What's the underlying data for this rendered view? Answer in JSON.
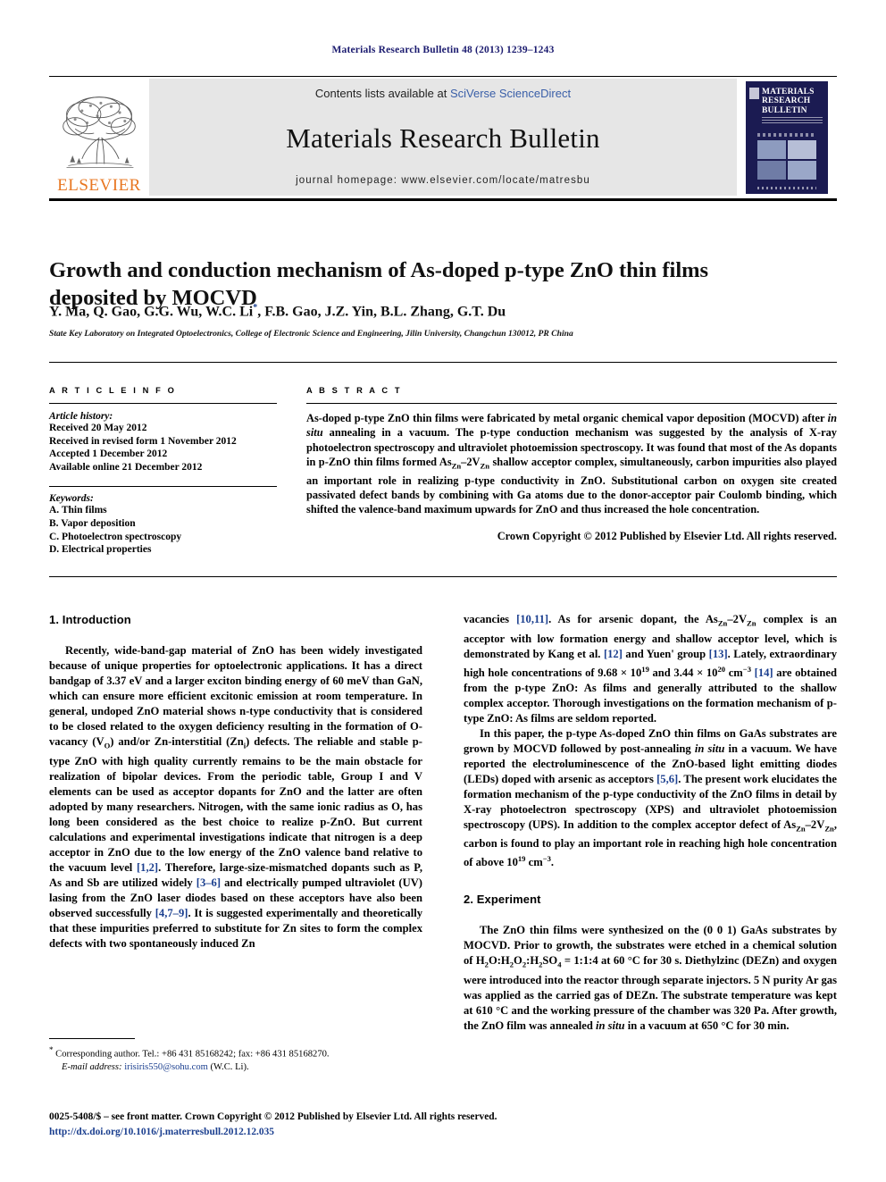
{
  "running_head": "Materials Research Bulletin 48 (2013) 1239–1243",
  "masthead": {
    "contents_prefix": "Contents lists available at ",
    "sciencedirect": "SciVerse ScienceDirect",
    "journal_name": "Materials Research Bulletin",
    "homepage": "journal homepage: www.elsevier.com/locate/matresbu",
    "publisher_logo_text": "ELSEVIER",
    "cover": {
      "line1": "MATERIALS",
      "line2": "RESEARCH",
      "line3": "BULLETIN"
    }
  },
  "article": {
    "title": "Growth and conduction mechanism of As-doped p-type ZnO thin films deposited by MOCVD",
    "authors_prefix": "Y. Ma, Q. Gao, G.G. Wu, W.C. Li",
    "authors_star": "*",
    "authors_suffix": ", F.B. Gao, J.Z. Yin, B.L. Zhang, G.T. Du",
    "affiliation": "State Key Laboratory on Integrated Optoelectronics, College of Electronic Science and Engineering, Jilin University, Changchun 130012, PR China"
  },
  "info": {
    "heading": "A R T I C L E  I N F O",
    "history_label": "Article history:",
    "history": [
      "Received 20 May 2012",
      "Received in revised form 1 November 2012",
      "Accepted 1 December 2012",
      "Available online 21 December 2012"
    ],
    "keywords_label": "Keywords:",
    "keywords": [
      "A. Thin films",
      "B. Vapor deposition",
      "C. Photoelectron spectroscopy",
      "D. Electrical properties"
    ]
  },
  "abstract": {
    "heading": "A B S T R A C T",
    "part1": "As-doped p-type ZnO thin films were fabricated by metal organic chemical vapor deposition (MOCVD) after ",
    "insitu1": "in situ",
    "part2": " annealing in a vacuum. The p-type conduction mechanism was suggested by the analysis of X-ray photoelectron spectroscopy and ultraviolet photoemission spectroscopy. It was found that most of the As dopants in p-ZnO thin films formed As",
    "sub1": "Zn",
    "part3": "–2V",
    "sub2": "Zn",
    "part4": " shallow acceptor complex, simultaneously, carbon impurities also played an important role in realizing p-type conductivity in ZnO. Substitutional carbon on oxygen site created passivated defect bands by combining with Ga atoms due to the donor-acceptor pair Coulomb binding, which shifted the valence-band maximum upwards for ZnO and thus increased the hole concentration.",
    "copyright": "Crown Copyright © 2012 Published by Elsevier Ltd. All rights reserved."
  },
  "sections": {
    "intro_heading": "1. Introduction",
    "experiment_heading": "2. Experiment"
  },
  "body": {
    "intro_p1_a": "Recently, wide-band-gap material of ZnO has been widely investigated because of unique properties for optoelectronic applications. It has a direct bandgap of 3.37 eV and a larger exciton binding energy of 60 meV than GaN, which can ensure more efficient excitonic emission at room temperature. In general, undoped ZnO material shows n-type conductivity that is considered to be closed related to the oxygen deficiency resulting in the formation of O-vacancy (V",
    "intro_sub_O": "O",
    "intro_p1_b": ") and/or Zn-interstitial (Zn",
    "intro_sub_i": "i",
    "intro_p1_c": ") defects. The reliable and stable p-type ZnO with high quality currently remains to be the main obstacle for realization of bipolar devices. From the periodic table, Group I and V elements can be used as acceptor dopants for ZnO and the latter are often adopted by many researchers. Nitrogen, with the same ionic radius as O, has long been considered as the best choice to realize p-ZnO. But current calculations and experimental investigations indicate that nitrogen is a deep acceptor in ZnO due to the low energy of the ZnO valence band relative to the vacuum level ",
    "ref_12": "[1,2]",
    "intro_p1_d": ". Therefore, large-size-mismatched dopants such as P, As and Sb are utilized widely ",
    "ref_36": "[3–6]",
    "intro_p1_e": " and electrically pumped ultraviolet (UV) lasing from the ZnO laser diodes based on these acceptors have also been observed successfully ",
    "ref_479": "[4,7–9]",
    "intro_p1_f": ". It is suggested experimentally and theoretically that these impurities preferred to substitute for Zn sites to form the complex defects with two spontaneously induced Zn",
    "right_p1_a": "vacancies ",
    "ref_1011": "[10,11]",
    "right_p1_b": ". As for arsenic dopant, the As",
    "right_sub_zn1": "Zn",
    "right_p1_c": "–2V",
    "right_sub_zn2": "Zn",
    "right_p1_d": " complex is an acceptor with low formation energy and shallow acceptor level, which is demonstrated by Kang et al. ",
    "ref_12b": "[12]",
    "right_p1_e": " and Yuen' group ",
    "ref_13": "[13]",
    "right_p1_f": ". Lately, extraordinary high hole concentrations of 9.68 × 10",
    "sup_19": "19",
    "right_p1_g": " and 3.44 × 10",
    "sup_20": "20",
    "right_p1_h": " cm",
    "sup_m3": "−3",
    "right_p1_i": " ",
    "ref_14": "[14]",
    "right_p1_j": " are obtained from the p-type ZnO: As films and generally attributed to the shallow complex acceptor. Thorough investigations on the formation mechanism of p-type ZnO: As films are seldom reported.",
    "right_p2_a": "In this paper, the p-type As-doped ZnO thin films on GaAs substrates are grown by MOCVD followed by post-annealing ",
    "insitu2": "in situ",
    "right_p2_b": " in a vacuum. We have reported the electroluminescence of the ZnO-based light emitting diodes (LEDs) doped with arsenic as acceptors ",
    "ref_56": "[5,6]",
    "right_p2_c": ". The present work elucidates the formation mechanism of the p-type conductivity of the ZnO films in detail by X-ray photoelectron spectroscopy (XPS) and ultraviolet photoemission spectroscopy (UPS). In addition to the complex acceptor defect of As",
    "right_sub_zn3": "Zn",
    "right_p2_d": "–2V",
    "right_sub_zn4": "Zn",
    "right_p2_e": ", carbon is found to play an important role in reaching high hole concentration of above 10",
    "sup_19b": "19",
    "right_p2_f": " cm",
    "sup_m3b": "−3",
    "right_p2_g": ".",
    "exp_p1_a": "The ZnO thin films were synthesized on the (0 0 1) GaAs substrates by MOCVD. Prior to growth, the substrates were etched in a chemical solution of H",
    "s2a": "2",
    "exp_p1_b": "O:H",
    "s2b": "2",
    "exp_p1_c": "O",
    "s2c": "2",
    "exp_p1_d": ":H",
    "s2d": "2",
    "exp_p1_e": "SO",
    "s4": "4",
    "exp_p1_f": " = 1:1:4 at 60 °C for 30 s. Diethylzinc (DEZn) and oxygen were introduced into the reactor through separate injectors. 5 N purity Ar gas was applied as the carried gas of DEZn. The substrate temperature was kept at 610 °C and the working pressure of the chamber was 320 Pa. After growth, the ZnO film was annealed ",
    "insitu3": "in situ",
    "exp_p1_g": " in a vacuum at 650 °C for 30 min."
  },
  "footnote": {
    "star": "*",
    "corresponding": " Corresponding author. Tel.: +86 431 85168242; fax: +86 431 85168270.",
    "email_label": "E-mail address:",
    "email": "irisiris550@sohu.com",
    "email_owner": " (W.C. Li)."
  },
  "bottom": {
    "issn": "0025-5408/$ – see front matter. Crown Copyright © 2012 Published by Elsevier Ltd. All rights reserved.",
    "doi": "http://dx.doi.org/10.1016/j.materresbull.2012.12.035"
  },
  "colors": {
    "link": "#1b3f8f",
    "running_head": "#1b1b6f",
    "elsevier_orange": "#E87722",
    "cover_navy": "#1b1b52",
    "mast_grey": "#e6e6e6"
  }
}
